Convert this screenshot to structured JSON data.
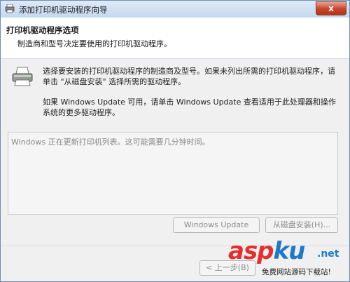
{
  "window": {
    "title": "添加打印机驱动程序向导",
    "close_label": "x"
  },
  "header": {
    "title": "打印机驱动程序选项",
    "subtitle": "制造商和型号决定要使用的打印机驱动程序。"
  },
  "body": {
    "description_1": "选择要安装的打印机驱动程序的制造商及型号。如果未列出所需的打印机驱动程序，请单击 \"从磁盘安装\" 选择所需的驱动程序。",
    "description_2": "如果 Windows Update 可用，请单击 Windows Update 查看适用于此处理器和操作系统的更多驱动程序。",
    "list_status": "Windows 正在更新打印机列表。这可能需要几分钟时间。"
  },
  "buttons": {
    "windows_update": "Windows Update",
    "have_disk": "从磁盘安装(H)...",
    "back": "< 上一步(B)"
  },
  "watermark": {
    "logo_a": "asp",
    "logo_b": "ku",
    "net": ".net",
    "subtitle": "免费网站源码下载站!"
  }
}
